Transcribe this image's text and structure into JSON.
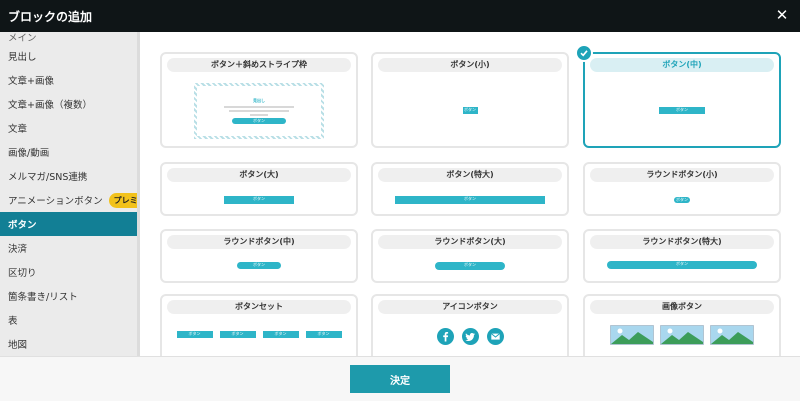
{
  "dialog": {
    "title": "ブロックの追加"
  },
  "sidebar": {
    "items": [
      {
        "label": "メイン"
      },
      {
        "label": "見出し"
      },
      {
        "label": "文章+画像"
      },
      {
        "label": "文章+画像（複数）"
      },
      {
        "label": "文章"
      },
      {
        "label": "画像/動画"
      },
      {
        "label": "メルマガ/SNS連携"
      },
      {
        "label": "アニメーションボタン",
        "badge": "プレミアム"
      },
      {
        "label": "ボタン"
      },
      {
        "label": "決済"
      },
      {
        "label": "区切り"
      },
      {
        "label": "箇条書き/リスト"
      },
      {
        "label": "表"
      },
      {
        "label": "地図"
      }
    ],
    "active_index": 8
  },
  "cards": [
    {
      "title": "ボタン＋斜めストライプ枠",
      "preview": "stripe",
      "stripe_heading": "見出し",
      "stripe_button": "ボタン",
      "selected": false
    },
    {
      "title": "ボタン(小)",
      "preview_label": "ボタン",
      "selected": false
    },
    {
      "title": "ボタン(中)",
      "preview_label": "ボタン",
      "selected": true
    },
    {
      "title": "ボタン(大)",
      "preview_label": "ボタン",
      "selected": false
    },
    {
      "title": "ボタン(特大)",
      "preview_label": "ボタン",
      "selected": false
    },
    {
      "title": "ラウンドボタン(小)",
      "preview_label": "ボタン",
      "selected": false
    },
    {
      "title": "ラウンドボタン(中)",
      "preview_label": "ボタン",
      "selected": false
    },
    {
      "title": "ラウンドボタン(大)",
      "preview_label": "ボタン",
      "selected": false
    },
    {
      "title": "ラウンドボタン(特大)",
      "preview_label": "ボタン",
      "selected": false
    },
    {
      "title": "ボタンセット",
      "preview_labels": [
        "ボタン",
        "ボタン",
        "ボタン",
        "ボタン"
      ],
      "selected": false
    },
    {
      "title": "アイコンボタン",
      "icons": [
        "facebook-icon",
        "twitter-icon",
        "mail-icon"
      ],
      "selected": false
    },
    {
      "title": "画像ボタン",
      "icons": [
        "landscape-image-icon",
        "landscape-image-icon",
        "landscape-image-icon"
      ],
      "selected": false
    }
  ],
  "footer": {
    "confirm_label": "決定"
  },
  "colors": {
    "accent": "#1ea3b8",
    "button": "#2eb5c8",
    "active": "#127f95",
    "badge": "#f2c21b"
  }
}
